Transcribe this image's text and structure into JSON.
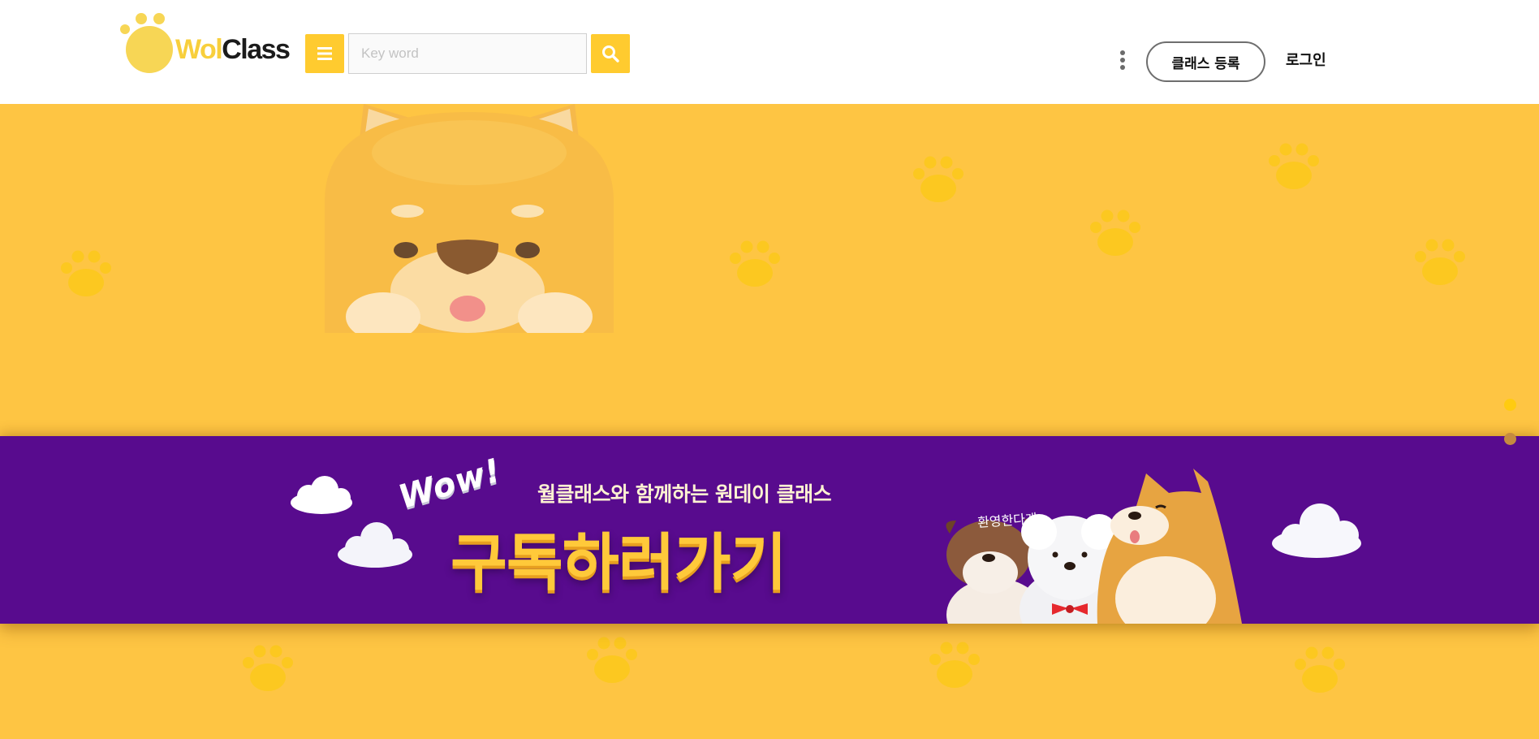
{
  "header": {
    "logo": {
      "part1": "Wol",
      "part2": "Class"
    },
    "search": {
      "placeholder": "Key word",
      "value": ""
    },
    "register_label": "클래스 등록",
    "login_label": "로그인"
  },
  "banner": {
    "wow": "Wow!",
    "subtitle": "월클래스와 함께하는 원데이 클래스",
    "title": "구독하러가기",
    "greeting": "환영한다개~"
  },
  "slider": {
    "active_index": 0,
    "total": 2
  },
  "colors": {
    "accent": "#ffcb2f",
    "hero_background": "#fec543",
    "banner_background": "#580b8e",
    "headline": "#ffc93a"
  },
  "icons": [
    "paw-logo-icon",
    "hamburger-menu-icon",
    "search-icon",
    "kebab-menu-icon",
    "paw-icon"
  ]
}
